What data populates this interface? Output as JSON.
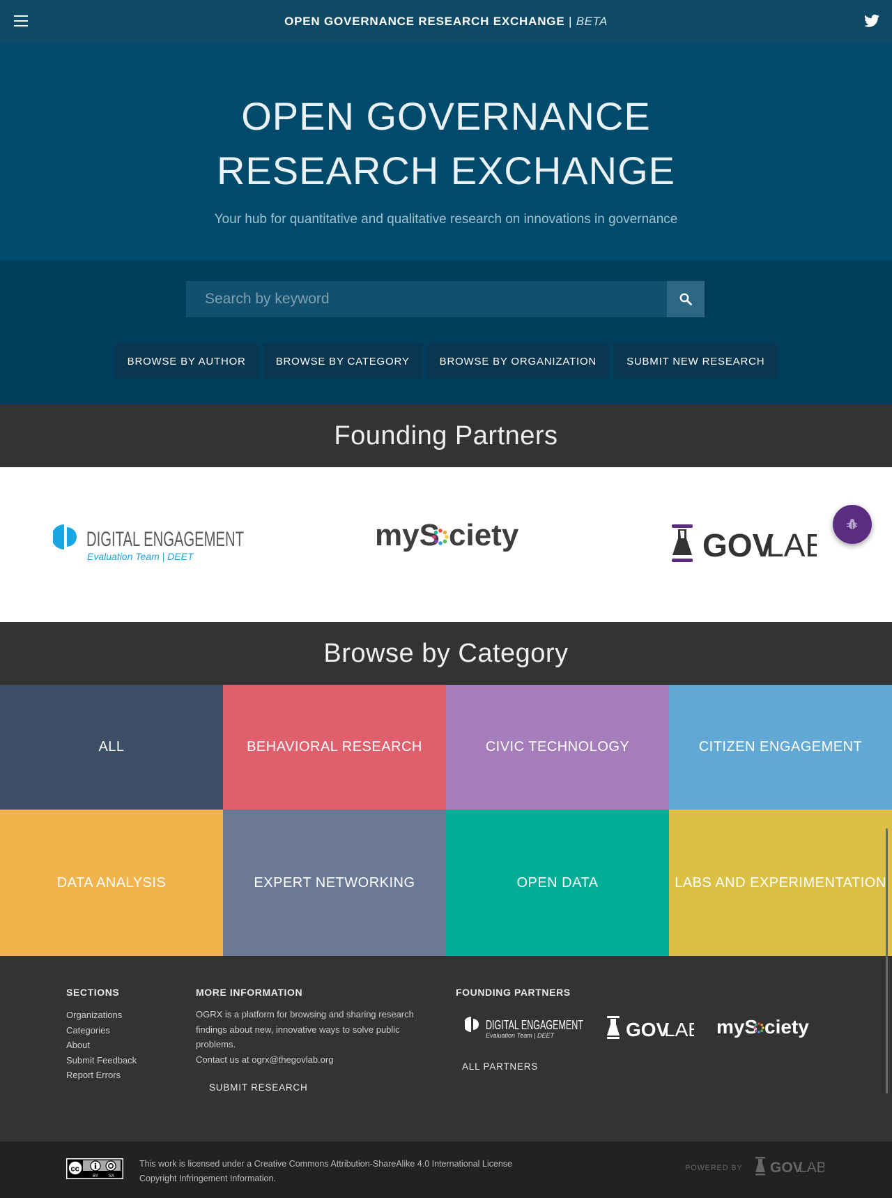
{
  "header": {
    "title": "OPEN GOVERNANCE RESEARCH EXCHANGE",
    "separator": "|",
    "beta": "BETA"
  },
  "hero": {
    "title_line1": "OPEN GOVERNANCE",
    "title_line2": "RESEARCH EXCHANGE",
    "subtitle": "Your hub for quantitative and qualitative research on innovations in governance"
  },
  "search": {
    "placeholder": "Search by keyword"
  },
  "browse": {
    "buttons": [
      "BROWSE BY AUTHOR",
      "BROWSE BY CATEGORY",
      "BROWSE BY ORGANIZATION",
      "SUBMIT NEW RESEARCH"
    ]
  },
  "founding_partners": {
    "heading": "Founding Partners",
    "digital_engagement": {
      "name": "DIGITAL ENGAGEMENT",
      "sub": "Evaluation Team | DEET"
    },
    "mysociety": {
      "pre": "myS",
      "post": "ciety"
    },
    "govlab": {
      "bold": "GOV",
      "light": "LAB"
    }
  },
  "categories": {
    "heading": "Browse by Category",
    "items": [
      {
        "label": "ALL",
        "color": "#3d4f66"
      },
      {
        "label": "BEHAVIORAL RESEARCH",
        "color": "#df5f6c"
      },
      {
        "label": "CIVIC TECHNOLOGY",
        "color": "#a47dba"
      },
      {
        "label": "CITIZEN ENGAGEMENT",
        "color": "#62a8d4"
      },
      {
        "label": "DATA ANALYSIS",
        "color": "#f2b24c"
      },
      {
        "label": "EXPERT NETWORKING",
        "color": "#6b7896"
      },
      {
        "label": "OPEN DATA",
        "color": "#00ad97"
      },
      {
        "label": "LABS AND EXPERIMENTATION",
        "color": "#dcc046"
      }
    ]
  },
  "footer": {
    "sections_heading": "SECTIONS",
    "sections": [
      "Organizations",
      "Categories",
      "About",
      "Submit Feedback",
      "Report Errors"
    ],
    "more_heading": "MORE INFORMATION",
    "more_text": "OGRX is a platform for browsing and sharing research findings about new, innovative ways to solve public problems.",
    "contact": "Contact us at ogrx@thegovlab.org",
    "submit": "SUBMIT RESEARCH",
    "partners_heading": "FOUNDING PARTNERS",
    "all_partners": "ALL PARTNERS"
  },
  "bottom": {
    "license": "This work is licensed under a Creative Commons Attribution-ShareAlike 4.0 International License",
    "copyright": "Copyright Infringement Information.",
    "powered_by": "POWERED BY",
    "cc_labels": [
      "BY",
      "SA"
    ]
  },
  "colors": {
    "topbar": "#0e4a66",
    "hero": "#004b6c",
    "search_band": "#003e5a",
    "dark": "#333333",
    "fab": "#5a2d82",
    "deet_blue": "#1aa6e3"
  },
  "icons": [
    "menu-icon",
    "twitter-icon",
    "search-icon",
    "bug-icon"
  ]
}
